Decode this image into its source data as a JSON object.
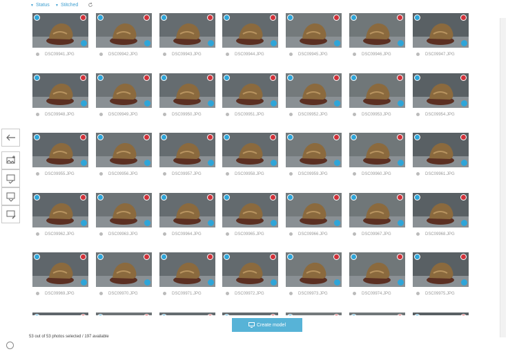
{
  "filters": {
    "status_label": "Status",
    "stitched_label": "Stitched"
  },
  "photos": [
    {
      "name": "DSC09941.JPG"
    },
    {
      "name": "DSC09942.JPG"
    },
    {
      "name": "DSC09943.JPG"
    },
    {
      "name": "DSC09944.JPG"
    },
    {
      "name": "DSC09945.JPG"
    },
    {
      "name": "DSC09946.JPG"
    },
    {
      "name": "DSC09947.JPG"
    },
    {
      "name": "DSC09948.JPG"
    },
    {
      "name": "DSC09949.JPG"
    },
    {
      "name": "DSC09950.JPG"
    },
    {
      "name": "DSC09951.JPG"
    },
    {
      "name": "DSC09952.JPG"
    },
    {
      "name": "DSC09953.JPG"
    },
    {
      "name": "DSC09954.JPG"
    },
    {
      "name": "DSC09955.JPG"
    },
    {
      "name": "DSC09956.JPG"
    },
    {
      "name": "DSC09957.JPG"
    },
    {
      "name": "DSC09958.JPG"
    },
    {
      "name": "DSC09959.JPG"
    },
    {
      "name": "DSC09960.JPG"
    },
    {
      "name": "DSC09961.JPG"
    },
    {
      "name": "DSC09962.JPG"
    },
    {
      "name": "DSC09963.JPG"
    },
    {
      "name": "DSC09964.JPG"
    },
    {
      "name": "DSC09965.JPG"
    },
    {
      "name": "DSC09966.JPG"
    },
    {
      "name": "DSC09967.JPG"
    },
    {
      "name": "DSC09968.JPG"
    },
    {
      "name": "DSC09969.JPG"
    },
    {
      "name": "DSC09970.JPG"
    },
    {
      "name": "DSC09971.JPG"
    },
    {
      "name": "DSC09972.JPG"
    },
    {
      "name": "DSC09973.JPG"
    },
    {
      "name": "DSC09974.JPG"
    },
    {
      "name": "DSC09975.JPG"
    },
    {
      "name": ""
    },
    {
      "name": ""
    },
    {
      "name": ""
    },
    {
      "name": ""
    },
    {
      "name": ""
    },
    {
      "name": ""
    },
    {
      "name": ""
    }
  ],
  "create_model_label": "Create model",
  "selection_status": "53 out of 53 photos selected / 197 available",
  "colors": {
    "accent": "#2fa5d8",
    "deselect": "#d0323a",
    "button": "#57b3d7"
  }
}
